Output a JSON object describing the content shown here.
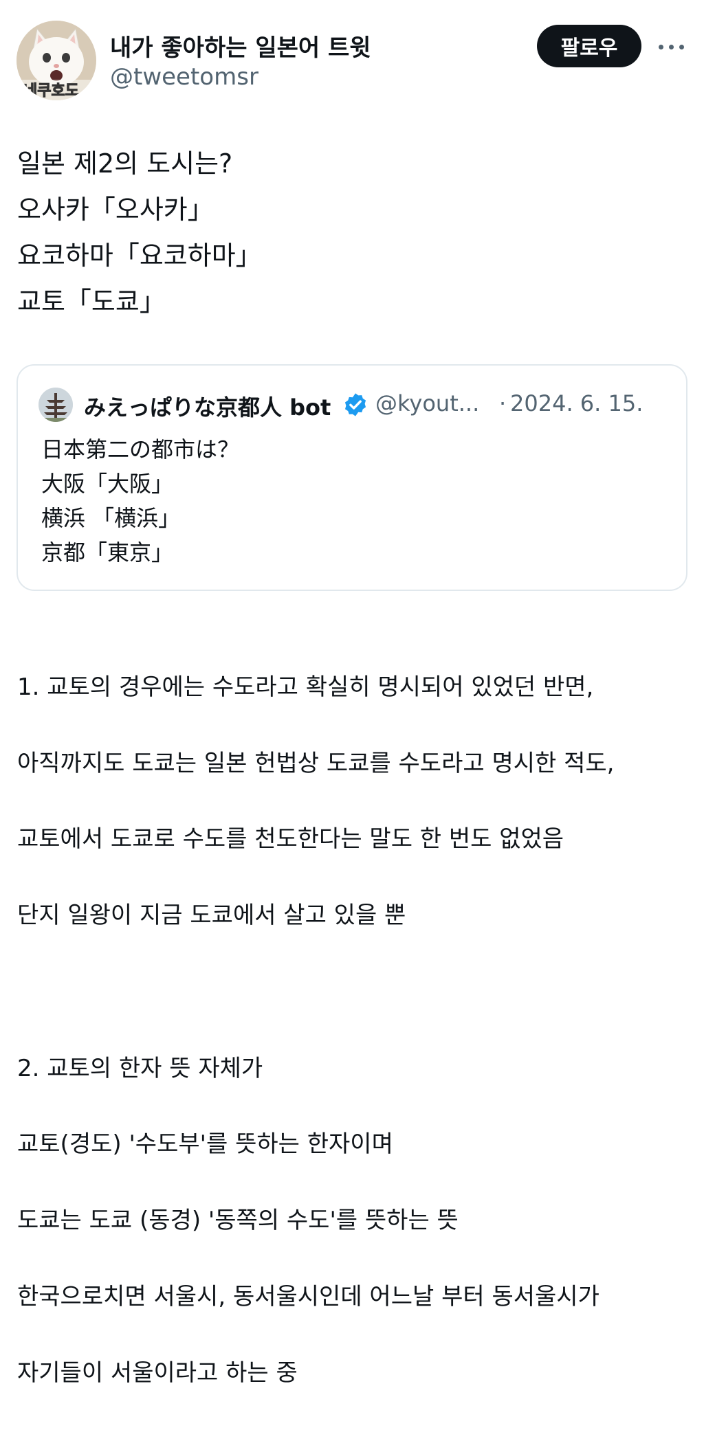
{
  "author": {
    "display_name": "내가 좋아하는 일본어 트윗",
    "handle": "@tweetomsr",
    "avatar_caption": "네쿠호도"
  },
  "actions": {
    "follow_label": "팔로우",
    "more_icon": "more-horizontal-icon"
  },
  "tweet": {
    "lines": [
      "일본 제2의 도시는?",
      "오사카「오사카」",
      "요코하마「요코하마」",
      "교토「도쿄」"
    ]
  },
  "quote": {
    "name": "みえっぱりな京都人 bot",
    "verified_icon": "verified-badge-icon",
    "handle": "@kyout...",
    "separator": "·",
    "date": "2024. 6. 15.",
    "lines": [
      "日本第二の都市は？",
      "大阪「大阪」",
      "横浜 「横浜」",
      "京都「東京」"
    ]
  },
  "body": {
    "lines": [
      "1. 교토의 경우에는 수도라고 확실히 명시되어 있었던 반면,",
      "아직까지도 도쿄는 일본 헌법상 도쿄를 수도라고 명시한 적도,",
      "교토에서 도쿄로 수도를 천도한다는 말도 한 번도 없었음",
      "단지 일왕이 지금 도쿄에서 살고 있을 뿐",
      "2. 교토의 한자 뜻 자체가",
      "교토(경도)  '수도부'를 뜻하는 한자이며",
      "도쿄는 도쿄 (동경) '동쪽의 수도'를 뜻하는 뜻",
      "한국으로치면 서울시, 동서울시인데 어느날 부터 동서울시가",
      "자기들이 서울이라고 하는 중"
    ]
  },
  "colors": {
    "text": "#0f1419",
    "secondary": "#536471",
    "follow_bg": "#0f1419",
    "card_border": "#e1e8ed",
    "verified": "#1d9bf0"
  }
}
